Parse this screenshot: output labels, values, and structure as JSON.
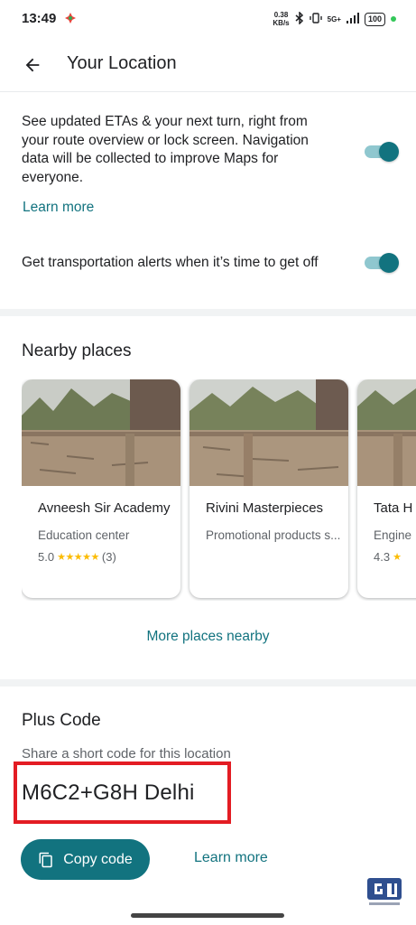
{
  "status_bar": {
    "time": "13:49",
    "net_speed_value": "0.38",
    "net_speed_unit": "KB/s",
    "network": "5G+",
    "battery": "100"
  },
  "app_bar": {
    "title": "Your Location",
    "back_icon": "arrow-back-icon"
  },
  "settings": {
    "navigation_text": "See updated ETAs & your next turn, right from your route overview or lock screen. Navigation data will be collected to improve Maps for everyone.",
    "navigation_toggle_on": true,
    "learn_more": "Learn more",
    "transport_text": "Get transportation alerts when it’s time to get off",
    "transport_toggle_on": true
  },
  "nearby": {
    "title": "Nearby places",
    "places": [
      {
        "name": "Avneesh Sir Academy",
        "category": "Education center",
        "rating": "5.0",
        "stars": "★★★★★",
        "count": "(3)"
      },
      {
        "name": "Rivini Masterpieces",
        "category": "Promotional products s...",
        "rating": "",
        "stars": "",
        "count": ""
      },
      {
        "name": "Tata H",
        "category": "Engine",
        "rating": "4.3",
        "stars": "★",
        "count": ""
      }
    ],
    "more_label": "More places nearby"
  },
  "plus_code": {
    "title": "Plus Code",
    "subtitle": "Share a short code for this location",
    "value": "M6C2+G8H Delhi",
    "copy_label": "Copy code",
    "learn_more": "Learn more"
  },
  "colors": {
    "accent": "#12737f",
    "highlight_box": "#e31c23",
    "star": "#fbbc04"
  }
}
